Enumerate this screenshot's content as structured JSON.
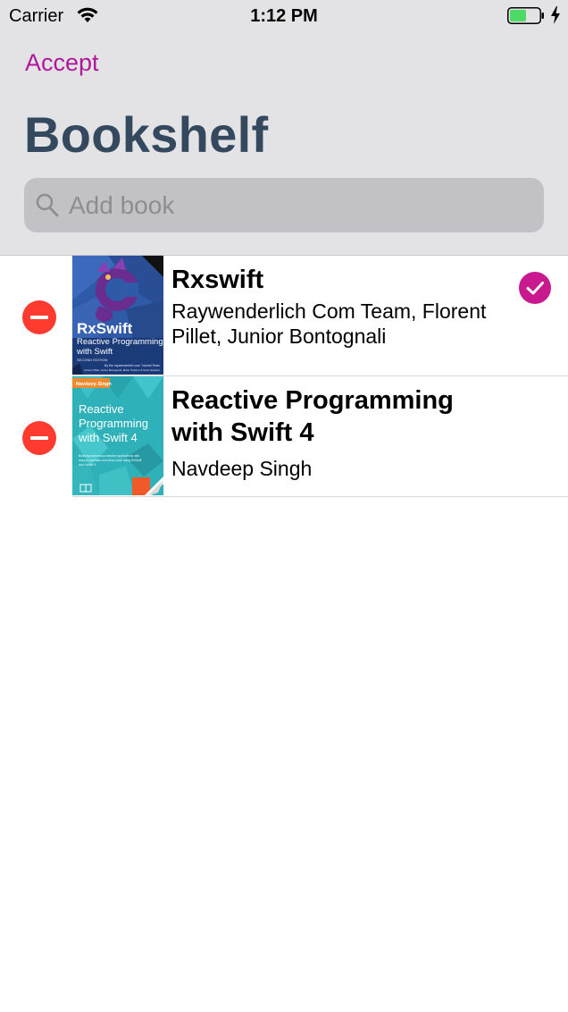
{
  "status_bar": {
    "carrier": "Carrier",
    "time": "1:12 PM",
    "battery_color": "#4cd964"
  },
  "nav": {
    "accept_label": "Accept",
    "title": "Bookshelf"
  },
  "search": {
    "placeholder": "Add book",
    "value": ""
  },
  "books": [
    {
      "title": "Rxswift",
      "author": "Raywenderlich Com Team, Florent Pillet, Junior Bontognali",
      "selected": true,
      "cover": {
        "title_line1": "RxSwift",
        "subtitle_line1": "Reactive Programming",
        "subtitle_line2": "with Swift",
        "edition": "SECOND EDITION",
        "byline1": "By the raywenderlich.com Tutorial Team",
        "byline2": "Florent Pillet, Junior Bontognali, Marin Todorov & Scott Gardner"
      }
    },
    {
      "title": "Reactive Programming with Swift 4",
      "author": "Navdeep Singh",
      "selected": false,
      "cover": {
        "author_tag": "Navdeep Singh",
        "title_line1": "Reactive",
        "title_line2": "Programming",
        "title_line3": "with Swift 4",
        "blurb1": "Build asynchronous reactive applications with",
        "blurb2": "easy-to-maintain and clean code using RxSwift",
        "blurb3": "and Xcode 9"
      }
    }
  ],
  "colors": {
    "accent": "#b0189c",
    "title": "#34495e",
    "delete": "#ff3b30",
    "check": "#c8198f"
  }
}
